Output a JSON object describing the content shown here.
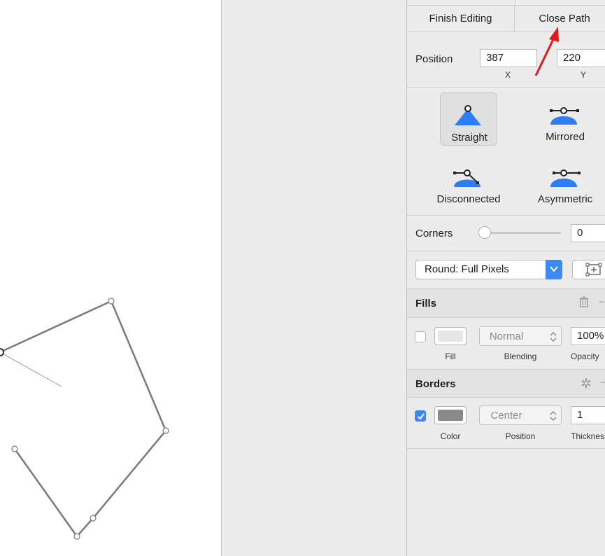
{
  "toolbar": {
    "finish_editing": "Finish Editing",
    "close_path": "Close Path"
  },
  "position": {
    "label": "Position",
    "x_value": "387",
    "x_label": "X",
    "y_value": "220",
    "y_label": "Y"
  },
  "point_types": [
    {
      "label": "Straight",
      "icon": "straight-point-icon",
      "selected": true
    },
    {
      "label": "Mirrored",
      "icon": "mirrored-point-icon",
      "selected": false
    },
    {
      "label": "Disconnected",
      "icon": "disconnected-point-icon",
      "selected": false
    },
    {
      "label": "Asymmetric",
      "icon": "asymmetric-point-icon",
      "selected": false
    }
  ],
  "corners": {
    "label": "Corners",
    "value": "0"
  },
  "rounding": {
    "selected": "Round: Full Pixels"
  },
  "fills": {
    "title": "Fills",
    "checked": false,
    "fill_label": "Fill",
    "blending_value": "Normal",
    "blending_label": "Blending",
    "opacity_value": "100%",
    "opacity_label": "Opacity",
    "fill_color": "#e6e6e6"
  },
  "borders": {
    "title": "Borders",
    "checked": true,
    "color_label": "Color",
    "position_value": "Center",
    "position_label": "Position",
    "thickness_value": "1",
    "thickness_label": "Thickness",
    "border_color": "#8a8a8a"
  },
  "colors": {
    "accent": "#3d8af7",
    "point_icon_blue": "#2f7df5",
    "annotation_arrow": "#e01b1b",
    "path_stroke": "#7a7a7a"
  }
}
